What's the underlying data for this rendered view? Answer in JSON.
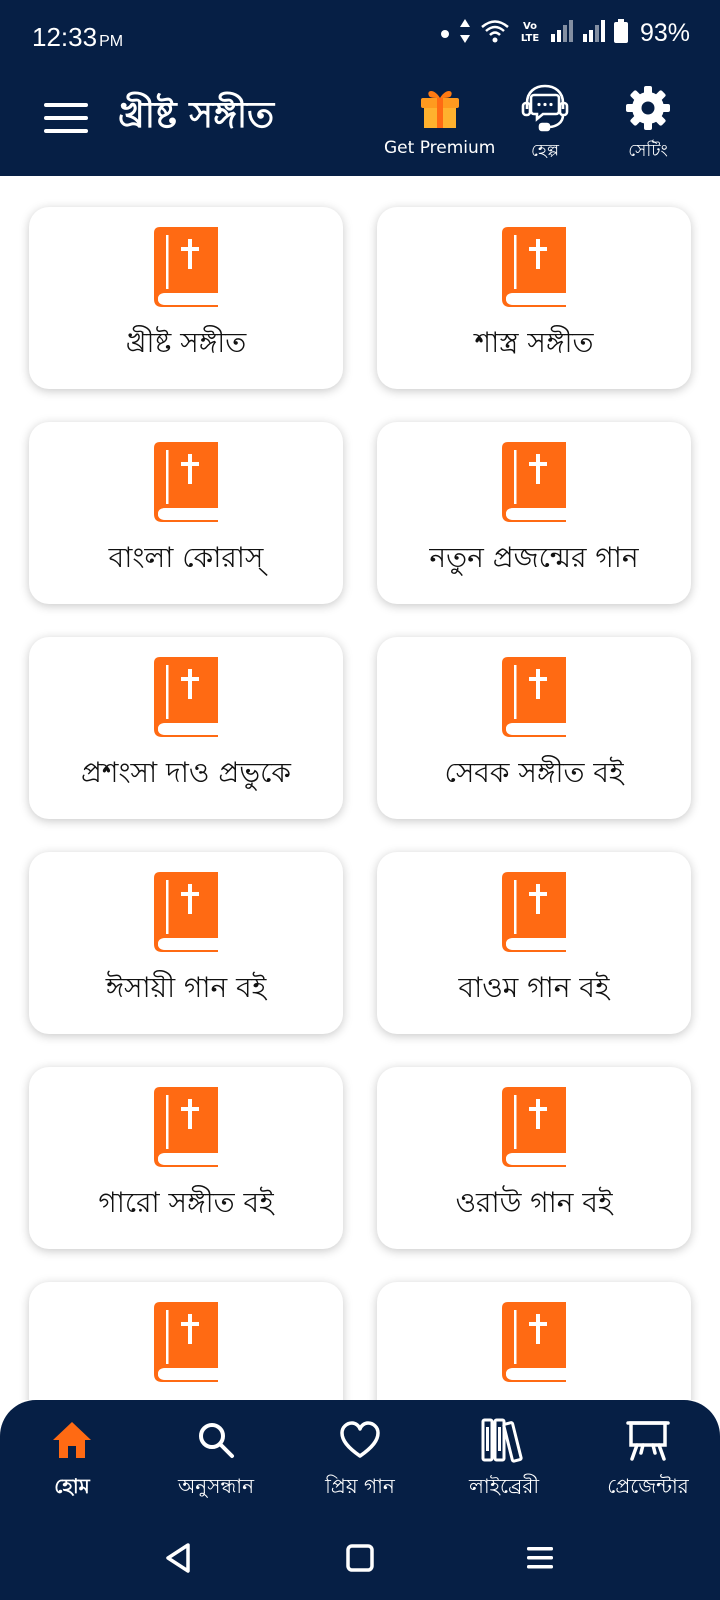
{
  "status_bar": {
    "time": "12:33",
    "ampm": "PM",
    "network_label": "VoLTE",
    "battery": "93%"
  },
  "app_bar": {
    "title": "খ্রীষ্ট সঙ্গীত",
    "actions": [
      {
        "label": "Get Premium",
        "icon": "gift-icon"
      },
      {
        "label": "হেল্প",
        "icon": "headset-chat-icon"
      },
      {
        "label": "সেটিং",
        "icon": "gear-icon"
      }
    ]
  },
  "songbooks": [
    {
      "title": "খ্রীষ্ট সঙ্গীত",
      "icon": "bible-book-icon"
    },
    {
      "title": "শাস্ত্র সঙ্গীত",
      "icon": "bible-book-icon"
    },
    {
      "title": "বাংলা কোরাস্",
      "icon": "bible-book-icon"
    },
    {
      "title": "নতুন প্রজন্মের গান",
      "icon": "bible-book-icon"
    },
    {
      "title": "প্রশংসা দাও প্রভুকে",
      "icon": "bible-book-icon"
    },
    {
      "title": "সেবক সঙ্গীত বই",
      "icon": "bible-book-icon"
    },
    {
      "title": "ঈসায়ী গান বই",
      "icon": "bible-book-icon"
    },
    {
      "title": "বাওম গান বই",
      "icon": "bible-book-icon"
    },
    {
      "title": "গারো সঙ্গীত বই",
      "icon": "bible-book-icon"
    },
    {
      "title": "ওরাউ গান বই",
      "icon": "bible-book-icon"
    },
    {
      "title": "",
      "icon": "bible-book-icon"
    },
    {
      "title": "",
      "icon": "bible-book-icon"
    }
  ],
  "bottom_nav": [
    {
      "label": "হোম",
      "icon": "home-icon",
      "active": true
    },
    {
      "label": "অনুসন্ধান",
      "icon": "search-icon",
      "active": false
    },
    {
      "label": "প্রিয় গান",
      "icon": "heart-icon",
      "active": false
    },
    {
      "label": "লাইব্রেরী",
      "icon": "library-icon",
      "active": false
    },
    {
      "label": "প্রেজেন্টার",
      "icon": "presenter-icon",
      "active": false
    }
  ],
  "colors": {
    "brand_navy": "#061f45",
    "accent_orange": "#ff6a13",
    "card_bg": "#ffffff",
    "text": "#111111"
  }
}
